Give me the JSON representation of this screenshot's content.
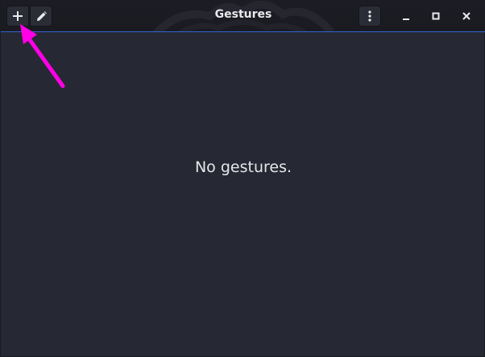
{
  "window": {
    "title": "Gestures"
  },
  "headerbar": {
    "buttons": {
      "add": {
        "icon": "plus-icon"
      },
      "edit": {
        "icon": "pencil-icon"
      },
      "menu": {
        "icon": "vertical-ellipsis-icon"
      },
      "minimize": {
        "icon": "minimize-icon"
      },
      "maximize": {
        "icon": "maximize-icon"
      },
      "close": {
        "icon": "close-icon"
      }
    }
  },
  "main": {
    "empty_text": "No gestures."
  },
  "annotation": {
    "color": "#ff00e6"
  },
  "colors": {
    "background": "#262833",
    "headerbar": "#1c1d24",
    "accent": "#3464d6",
    "text": "#e8e9ec"
  }
}
